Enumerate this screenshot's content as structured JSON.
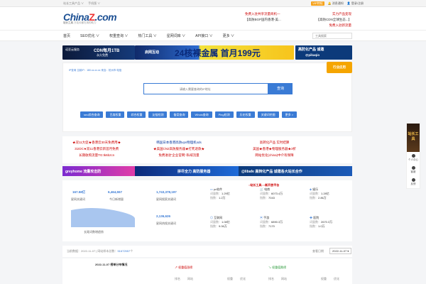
{
  "topbar": {
    "left": [
      "站长工具产品 ∨",
      "手机版 ∨"
    ],
    "vip": "VIP特权",
    "notice": "消息通知",
    "login": "登录/注册"
  },
  "logo": {
    "name": "China",
    "z": "Z",
    "com": ".com",
    "sub": "站长工具",
    "slogan": "万站长都在用的助力"
  },
  "header_ads": [
    [
      "免费入驻共享流量商机—",
      "实力产品变现"
    ],
    [
      "【高防BGP国内香港-美...",
      "【高防CDN全球生态...】"
    ],
    [
      "",
      "",
      "免费入驻新流量"
    ]
  ],
  "nav": {
    "items": [
      "首页",
      "SEO优化 ∨",
      "权重查询 ∨",
      "热门工具 ∨",
      "星网词库 ∨",
      "API接口 ∨",
      "更多 ∨"
    ],
    "search_placeholder": "工具搜索"
  },
  "banners": {
    "b1_title": "CDN每月1TB",
    "b1_sub": "永久免费",
    "b1_brand": "诺亚云服务",
    "b2_brand": "启网互动",
    "b2_text": "24核裸金属 首月199元",
    "b3_t1": "高防化产品 诚邀",
    "b3_t2": "@pikaqio"
  },
  "search": {
    "crumb": "IP查询 当前IP：180.xx.xx.xx 来自：杭州市 电信",
    "placeholder": "请输入需要查询的IP地址",
    "button": "查询",
    "badge": "行业应用",
    "tags": [
      "seo综合查询",
      "百度权重",
      "综合权重",
      "友链检测",
      "备案查询",
      "Whois查询",
      "Ping检测",
      "历史权重",
      "关键词挖掘",
      "更多 >"
    ]
  },
  "text_ads": {
    "col1": [
      "★双11大促★香港云30天免费用★",
      "31IDC★双11香港云新首月免费",
      "长期收购流量TG:tk6bzcn"
    ],
    "col2": [
      "韩国日本香港高防vps物理机sds",
      "★美国CN2高防服务器★打死退款★",
      "免费进驻'企业官网'-私域流量"
    ],
    "col3": [
      "高转化产品 实时结算",
      "美国★香港★物理服务器★3折",
      "网站优化(china)中介有保障"
    ]
  },
  "banner2": {
    "b1": "greyhome 流量攻击防",
    "b2": "拼尽全力 高防服务器",
    "b3": "@libafe 高转化产品 诚邀各大站长合作"
  },
  "stats": {
    "a_val": "167.58亿",
    "a_lbl": "星网关键词",
    "b_val": "6,464,557",
    "b_lbl": "今日新增量",
    "c_val": "1,743,378,197",
    "c_lbl": "星网搜索关键词",
    "d_val": "2,136,626",
    "d_lbl": "星网热搜关键词",
    "chart_lbl": "长尾词数增趋势",
    "cats": [
      {
        "name": "pc软件",
        "l1": "词量数：",
        "v1": "1.29亿",
        "l2": "指数：",
        "v2": "1.2万"
      },
      {
        "name": "电商",
        "l1": "词量数：",
        "v1": "6073.4万",
        "l2": "指数：",
        "v2": "7043"
      },
      {
        "name": "娱乐",
        "l1": "词量数：",
        "v1": "1.28亿",
        "l2": "指数：",
        "v2": "2.86万"
      },
      {
        "name": "互联网",
        "l1": "词量数：",
        "v1": "1.08亿",
        "l2": "指数：",
        "v2": "9.06万"
      },
      {
        "name": "手游",
        "l1": "词量数：",
        "v1": "6890.3万",
        "l2": "指数：",
        "v2": "7170"
      },
      {
        "name": "医院",
        "l1": "词量数：",
        "v1": "2670.3万",
        "l2": "指数：",
        "v2": "1.0万"
      }
    ],
    "ad": "○站长工具○○新开放平台"
  },
  "filter": {
    "label": "当前数据：2022-11-07 | 网站样本总数：",
    "count": "51672557",
    "link": "个",
    "date_lbl": "查看日期",
    "date": "2022-11-07"
  },
  "bottom": {
    "title": "2022-11-07 榜单分布情况",
    "rise": "权重值涨榜",
    "fall": "权重值跌榜",
    "cols": [
      "排名",
      "网站",
      "权重",
      "优化"
    ]
  },
  "side": {
    "top": "站长工具",
    "items": [
      "个人中心",
      "客服",
      "反馈"
    ]
  }
}
